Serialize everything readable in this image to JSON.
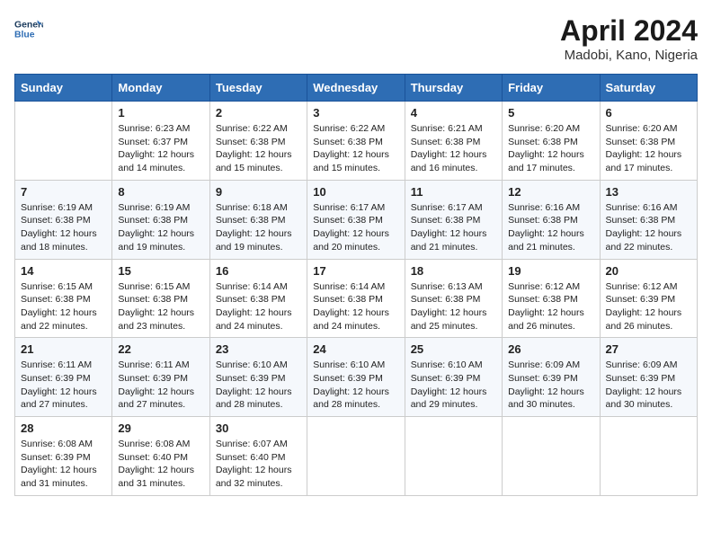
{
  "header": {
    "logo_line1": "General",
    "logo_line2": "Blue",
    "title": "April 2024",
    "subtitle": "Madobi, Kano, Nigeria"
  },
  "calendar": {
    "days_of_week": [
      "Sunday",
      "Monday",
      "Tuesday",
      "Wednesday",
      "Thursday",
      "Friday",
      "Saturday"
    ],
    "weeks": [
      [
        {
          "day": "",
          "info": ""
        },
        {
          "day": "1",
          "info": "Sunrise: 6:23 AM\nSunset: 6:37 PM\nDaylight: 12 hours and 14 minutes."
        },
        {
          "day": "2",
          "info": "Sunrise: 6:22 AM\nSunset: 6:38 PM\nDaylight: 12 hours and 15 minutes."
        },
        {
          "day": "3",
          "info": "Sunrise: 6:22 AM\nSunset: 6:38 PM\nDaylight: 12 hours and 15 minutes."
        },
        {
          "day": "4",
          "info": "Sunrise: 6:21 AM\nSunset: 6:38 PM\nDaylight: 12 hours and 16 minutes."
        },
        {
          "day": "5",
          "info": "Sunrise: 6:20 AM\nSunset: 6:38 PM\nDaylight: 12 hours and 17 minutes."
        },
        {
          "day": "6",
          "info": "Sunrise: 6:20 AM\nSunset: 6:38 PM\nDaylight: 12 hours and 17 minutes."
        }
      ],
      [
        {
          "day": "7",
          "info": "Sunrise: 6:19 AM\nSunset: 6:38 PM\nDaylight: 12 hours and 18 minutes."
        },
        {
          "day": "8",
          "info": "Sunrise: 6:19 AM\nSunset: 6:38 PM\nDaylight: 12 hours and 19 minutes."
        },
        {
          "day": "9",
          "info": "Sunrise: 6:18 AM\nSunset: 6:38 PM\nDaylight: 12 hours and 19 minutes."
        },
        {
          "day": "10",
          "info": "Sunrise: 6:17 AM\nSunset: 6:38 PM\nDaylight: 12 hours and 20 minutes."
        },
        {
          "day": "11",
          "info": "Sunrise: 6:17 AM\nSunset: 6:38 PM\nDaylight: 12 hours and 21 minutes."
        },
        {
          "day": "12",
          "info": "Sunrise: 6:16 AM\nSunset: 6:38 PM\nDaylight: 12 hours and 21 minutes."
        },
        {
          "day": "13",
          "info": "Sunrise: 6:16 AM\nSunset: 6:38 PM\nDaylight: 12 hours and 22 minutes."
        }
      ],
      [
        {
          "day": "14",
          "info": "Sunrise: 6:15 AM\nSunset: 6:38 PM\nDaylight: 12 hours and 22 minutes."
        },
        {
          "day": "15",
          "info": "Sunrise: 6:15 AM\nSunset: 6:38 PM\nDaylight: 12 hours and 23 minutes."
        },
        {
          "day": "16",
          "info": "Sunrise: 6:14 AM\nSunset: 6:38 PM\nDaylight: 12 hours and 24 minutes."
        },
        {
          "day": "17",
          "info": "Sunrise: 6:14 AM\nSunset: 6:38 PM\nDaylight: 12 hours and 24 minutes."
        },
        {
          "day": "18",
          "info": "Sunrise: 6:13 AM\nSunset: 6:38 PM\nDaylight: 12 hours and 25 minutes."
        },
        {
          "day": "19",
          "info": "Sunrise: 6:12 AM\nSunset: 6:38 PM\nDaylight: 12 hours and 26 minutes."
        },
        {
          "day": "20",
          "info": "Sunrise: 6:12 AM\nSunset: 6:39 PM\nDaylight: 12 hours and 26 minutes."
        }
      ],
      [
        {
          "day": "21",
          "info": "Sunrise: 6:11 AM\nSunset: 6:39 PM\nDaylight: 12 hours and 27 minutes."
        },
        {
          "day": "22",
          "info": "Sunrise: 6:11 AM\nSunset: 6:39 PM\nDaylight: 12 hours and 27 minutes."
        },
        {
          "day": "23",
          "info": "Sunrise: 6:10 AM\nSunset: 6:39 PM\nDaylight: 12 hours and 28 minutes."
        },
        {
          "day": "24",
          "info": "Sunrise: 6:10 AM\nSunset: 6:39 PM\nDaylight: 12 hours and 28 minutes."
        },
        {
          "day": "25",
          "info": "Sunrise: 6:10 AM\nSunset: 6:39 PM\nDaylight: 12 hours and 29 minutes."
        },
        {
          "day": "26",
          "info": "Sunrise: 6:09 AM\nSunset: 6:39 PM\nDaylight: 12 hours and 30 minutes."
        },
        {
          "day": "27",
          "info": "Sunrise: 6:09 AM\nSunset: 6:39 PM\nDaylight: 12 hours and 30 minutes."
        }
      ],
      [
        {
          "day": "28",
          "info": "Sunrise: 6:08 AM\nSunset: 6:39 PM\nDaylight: 12 hours and 31 minutes."
        },
        {
          "day": "29",
          "info": "Sunrise: 6:08 AM\nSunset: 6:40 PM\nDaylight: 12 hours and 31 minutes."
        },
        {
          "day": "30",
          "info": "Sunrise: 6:07 AM\nSunset: 6:40 PM\nDaylight: 12 hours and 32 minutes."
        },
        {
          "day": "",
          "info": ""
        },
        {
          "day": "",
          "info": ""
        },
        {
          "day": "",
          "info": ""
        },
        {
          "day": "",
          "info": ""
        }
      ]
    ]
  }
}
